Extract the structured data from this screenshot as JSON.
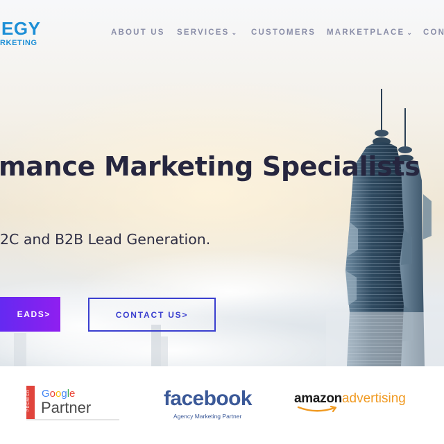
{
  "header": {
    "logo_main": "EGY",
    "logo_sub": "RKETING",
    "nav": [
      {
        "label": "ABOUT US",
        "has_dropdown": false
      },
      {
        "label": "SERVICES",
        "has_dropdown": true
      },
      {
        "label": "CUSTOMERS",
        "has_dropdown": false
      },
      {
        "label": "MARKETPLACE",
        "has_dropdown": true
      },
      {
        "label": "CONT",
        "has_dropdown": false
      }
    ],
    "dropdown_icon": "chevron-down-icon"
  },
  "hero": {
    "headline": "mance Marketing Specialists",
    "subline": "2C and B2B Lead Generation.",
    "primary_button": "EADS>",
    "secondary_button": "CONTACT US>"
  },
  "partners": {
    "google": {
      "vertical": "PREMIER",
      "brand": "Google",
      "label": "Partner"
    },
    "facebook": {
      "brand": "facebook",
      "sub": "Agency Marketing Partner"
    },
    "amazon": {
      "brand_a": "amazon",
      "brand_b": "advertising"
    }
  },
  "colors": {
    "logo": "#1d8fd6",
    "nav": "#8a8ea8",
    "headline": "#26263f",
    "primary_gradient_start": "#5b2cf1",
    "primary_gradient_end": "#8f1ff0",
    "secondary_border": "#3a3fcf",
    "facebook": "#3b5998",
    "amazon_orange": "#f09a22"
  }
}
